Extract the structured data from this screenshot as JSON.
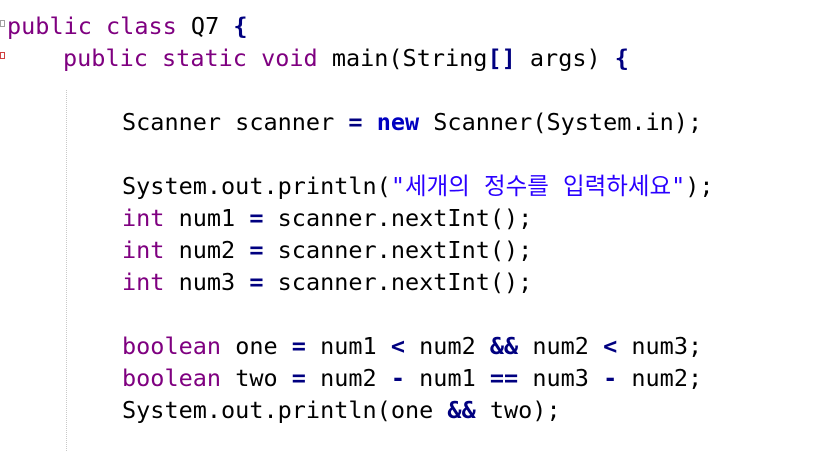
{
  "colors": {
    "keyword": "#7f0055",
    "keyword_new": "#0000c0",
    "string": "#2a00ff",
    "operator": "#000080",
    "text": "#000000"
  },
  "code": {
    "line1": {
      "kw": "public class",
      "name": " Q7 ",
      "brace": "{"
    },
    "line2": {
      "kw": "public static void",
      "rest": " main(String",
      "br": "[]",
      "rest2": " args) ",
      "brace": "{"
    },
    "line3": {
      "type": "Scanner scanner ",
      "eq": "=",
      "sp": " ",
      "kw": "new",
      "rest": " Scanner(System.in);"
    },
    "line4": {
      "pre": "System.out.println(",
      "str": "\"세개의 정수를 입력하세요\"",
      "post": ");"
    },
    "line5": {
      "kw": "int",
      "rest": " num1 ",
      "eq": "=",
      "rest2": " scanner.nextInt();"
    },
    "line6": {
      "kw": "int",
      "rest": " num2 ",
      "eq": "=",
      "rest2": " scanner.nextInt();"
    },
    "line7": {
      "kw": "int",
      "rest": " num3 ",
      "eq": "=",
      "rest2": " scanner.nextInt();"
    },
    "line8": {
      "kw": "boolean",
      "a": " one ",
      "eq": "=",
      "b": " num1 ",
      "lt": "<",
      "c": " num2 ",
      "and": "&&",
      "d": " num2 ",
      "lt2": "<",
      "e": " num3;"
    },
    "line9": {
      "kw": "boolean",
      "a": " two ",
      "eq": "=",
      "b": " num2 ",
      "minus": "-",
      "c": " num1 ",
      "eqeq": "==",
      "d": " num3 ",
      "minus2": "-",
      "e": " num2;"
    },
    "line10": {
      "pre": "System.out.println(one ",
      "and": "&&",
      "post": " two);"
    }
  }
}
